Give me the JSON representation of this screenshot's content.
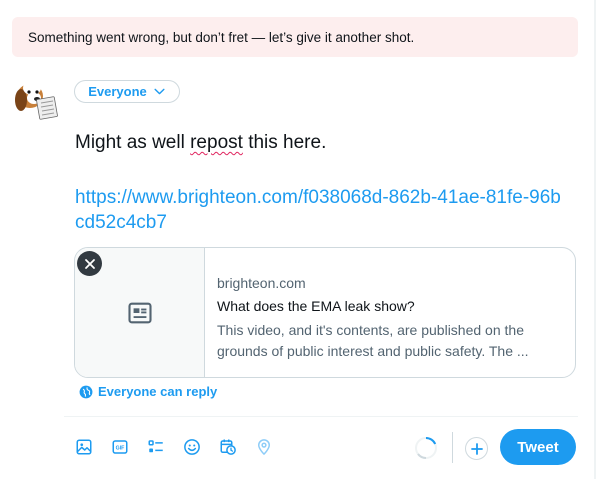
{
  "error": {
    "message": "Something went wrong, but don’t fret — let’s give it another shot."
  },
  "audience": {
    "label": "Everyone",
    "icon": "chevron-down-icon"
  },
  "compose": {
    "text_before": "Might as well ",
    "text_typo": "repost",
    "text_after": " this here.",
    "url": "https://www.brighteon.com/f038068d-862b-41ae-81fe-96bcd52c4cb7"
  },
  "card": {
    "domain": "brighteon.com",
    "title": "What does the EMA leak show?",
    "description": "This video, and it's contents, are published on the grounds of public interest and public safety. The ..."
  },
  "reply_setting": {
    "label": "Everyone can reply",
    "icon": "globe-icon"
  },
  "toolbar": {
    "icons": [
      "image-icon",
      "gif-icon",
      "poll-icon",
      "emoji-icon",
      "schedule-icon",
      "location-icon"
    ],
    "gif_text": "GIF",
    "tweet_label": "Tweet"
  },
  "colors": {
    "accent": "#1d9bf0",
    "error_bg": "#fdeeee",
    "border": "#cfd9de"
  }
}
